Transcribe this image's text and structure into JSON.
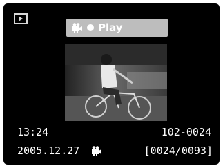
{
  "mode_icon": "playback-mode-icon",
  "header": {
    "movie_icon": "movie-camera-icon",
    "record_icon": "record-dot-icon",
    "play_label": "Play"
  },
  "thumbnail": {
    "icon": "photo-thumbnail"
  },
  "info": {
    "time": "13:24",
    "file_number": "102-0024",
    "date": "2005.12.27",
    "date_icon": "movie-camera-icon",
    "frame_counter": "[0024/0093]"
  },
  "colors": {
    "background": "#000000",
    "play_bar": "#bdbdbd",
    "text": "#ffffff"
  }
}
